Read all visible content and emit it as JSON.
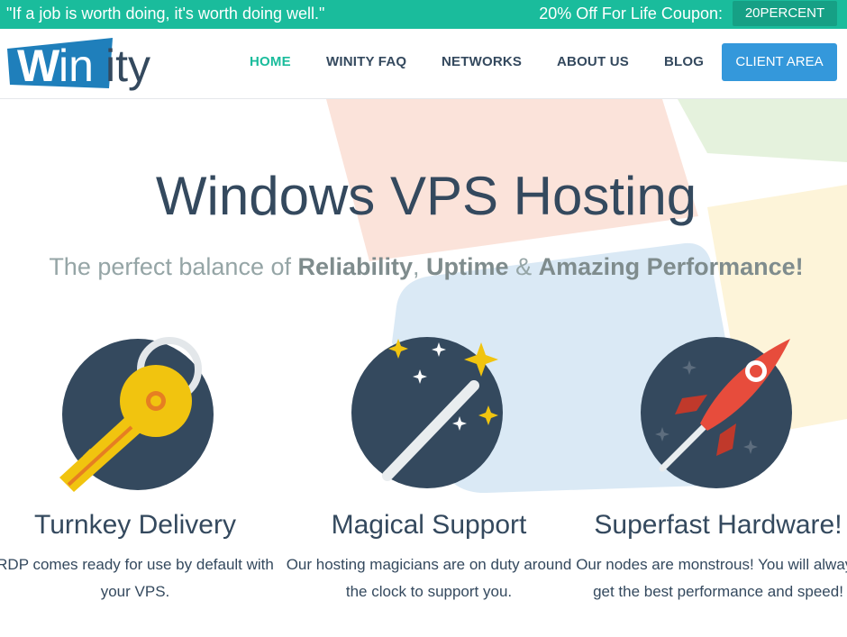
{
  "topbar": {
    "quote": "\"If a job is worth doing, it's worth doing well.\"",
    "coupon_label": "20% Off For Life Coupon:",
    "coupon_code": "20PERCENT"
  },
  "header": {
    "logo_text": "Winity",
    "nav": [
      "HOME",
      "WINITY FAQ",
      "NETWORKS",
      "ABOUT US",
      "BLOG"
    ],
    "client_area": "CLIENT AREA"
  },
  "hero": {
    "title": "Windows VPS Hosting",
    "subtitle_prefix": "The perfect balance of ",
    "subtitle_b1": "Reliability",
    "subtitle_sep1": ", ",
    "subtitle_b2": "Uptime",
    "subtitle_sep2": " & ",
    "subtitle_b3": "Amazing Performance",
    "subtitle_end": "!"
  },
  "features": [
    {
      "title": "Turnkey Delivery",
      "text": "RDP comes ready for use by default with your VPS.",
      "icon": "key-icon"
    },
    {
      "title": "Magical Support",
      "text": "Our hosting magicians are on duty around the clock to support you.",
      "icon": "magic-wand-icon"
    },
    {
      "title": "Superfast Hardware!",
      "text": "Our nodes are monstrous! You will always get the best performance and speed!",
      "icon": "rocket-icon"
    }
  ],
  "colors": {
    "accent": "#1abc9c",
    "button": "#3498db",
    "dark": "#34495e"
  }
}
